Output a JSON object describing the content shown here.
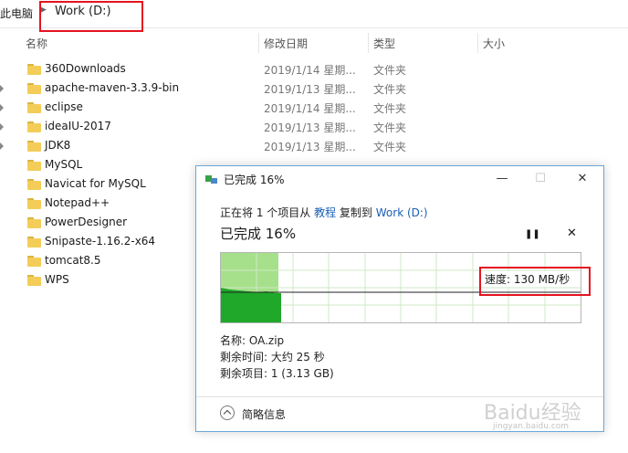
{
  "address": {
    "root": "此电脑",
    "current": "Work (D:)"
  },
  "columns": {
    "name": "名称",
    "modified": "修改日期",
    "type": "类型",
    "size": "大小"
  },
  "files": [
    {
      "name": "360Downloads",
      "date": "2019/1/14 星期...",
      "type": "文件夹"
    },
    {
      "name": "apache-maven-3.3.9-bin",
      "date": "2019/1/13 星期...",
      "type": "文件夹"
    },
    {
      "name": "eclipse",
      "date": "2019/1/14 星期...",
      "type": "文件夹"
    },
    {
      "name": "ideaIU-2017",
      "date": "2019/1/13 星期...",
      "type": "文件夹"
    },
    {
      "name": "JDK8",
      "date": "2019/1/13 星期...",
      "type": "文件夹"
    },
    {
      "name": "MySQL",
      "date": "",
      "type": ""
    },
    {
      "name": "Navicat for MySQL",
      "date": "",
      "type": ""
    },
    {
      "name": "Notepad++",
      "date": "",
      "type": ""
    },
    {
      "name": "PowerDesigner",
      "date": "",
      "type": ""
    },
    {
      "name": "Snipaste-1.16.2-x64",
      "date": "",
      "type": ""
    },
    {
      "name": "tomcat8.5",
      "date": "",
      "type": ""
    },
    {
      "name": "WPS",
      "date": "",
      "type": ""
    }
  ],
  "dialog": {
    "title": "已完成 16%",
    "minimize": "—",
    "maximize": "☐",
    "close": "✕",
    "status_prefix": "正在将 1 个项目从 ",
    "source": "教程",
    "status_middle": " 复制到 ",
    "destination": "Work (D:)",
    "progress_text": "已完成 16%",
    "progress_percent": 16,
    "pause": "❚❚",
    "cancel": "✕",
    "speed_label": "速度: 130 MB/秒",
    "name_line": "名称: OA.zip",
    "time_line": "剩余时间: 大约 25 秒",
    "items_line": "剩余项目: 1 (3.13 GB)",
    "details_toggle": "简略信息"
  },
  "watermark": {
    "text": "Baidu经验",
    "url": "jingyan.baidu.com"
  },
  "colors": {
    "highlight_red": "#e4141e",
    "progress_light": "#a6e08b",
    "progress_dark": "#1fa829",
    "link_blue": "#1b5fb4",
    "folder_yellow": "#f3cd58"
  }
}
